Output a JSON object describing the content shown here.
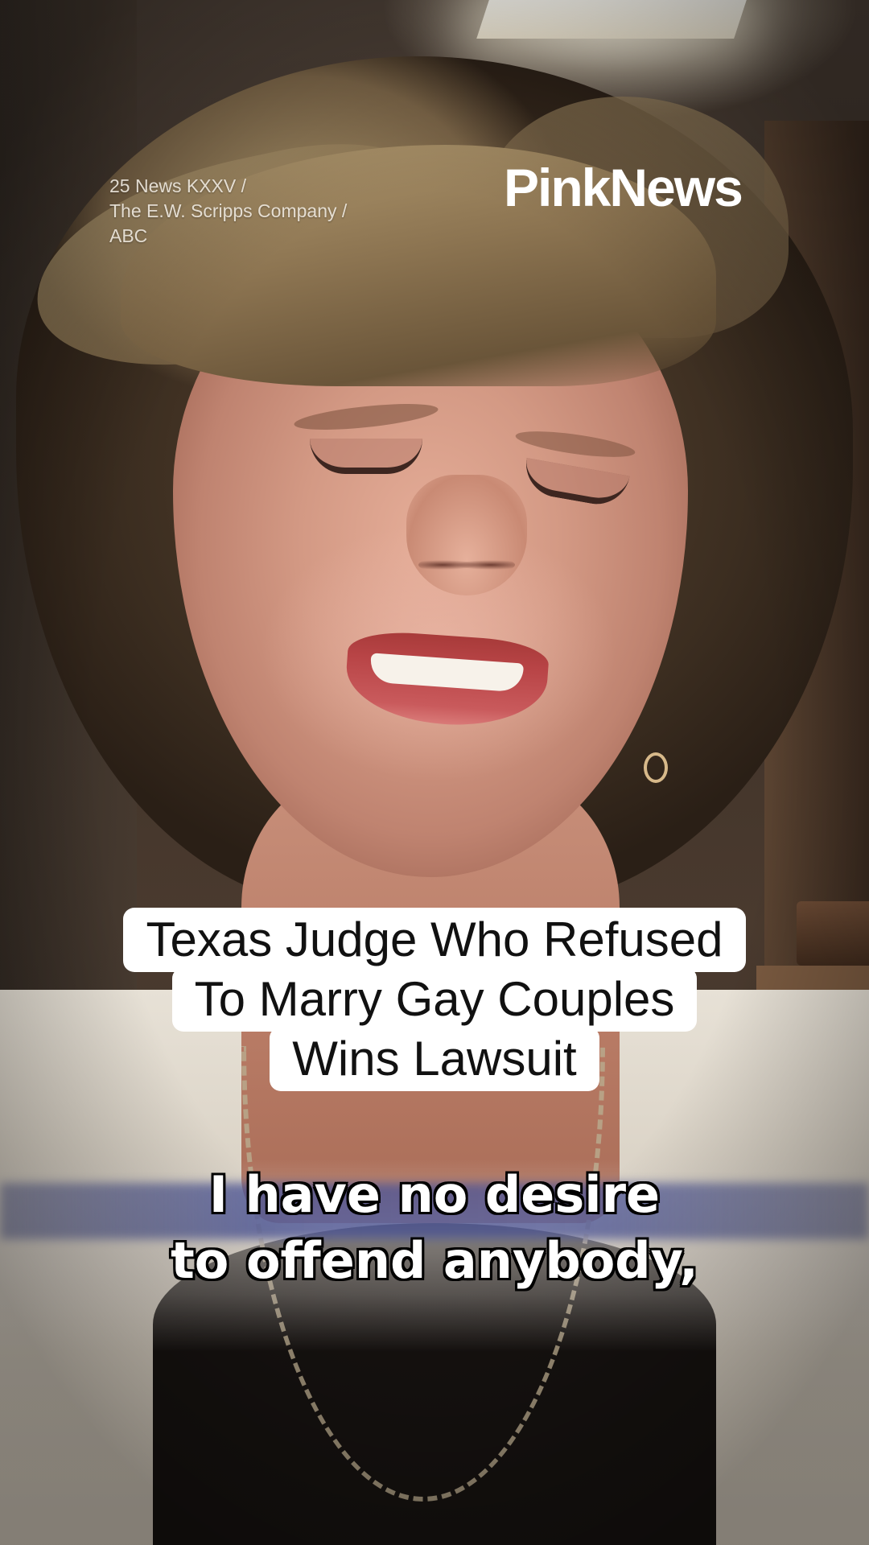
{
  "credit": {
    "lines": [
      "25 News KXXV /",
      "The E.W. Scripps Company /",
      "ABC"
    ]
  },
  "logo": {
    "text": "PinkNews"
  },
  "headline": {
    "lines": [
      "Texas Judge Who Refused",
      "To Marry Gay Couples",
      "Wins Lawsuit"
    ]
  },
  "subtitle": {
    "lines": [
      "I have no desire",
      "to offend anybody,"
    ]
  },
  "colors": {
    "headline_bg": "#ffffff",
    "headline_text": "#111111",
    "subtitle_text": "#ffffff",
    "subtitle_outline": "#000000",
    "logo_text": "#ffffff"
  }
}
